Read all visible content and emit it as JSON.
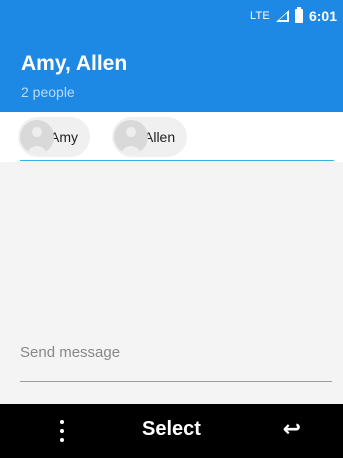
{
  "status_bar": {
    "network": "LTE",
    "time": "6:01"
  },
  "header": {
    "title": "Amy, Allen",
    "subtitle": "2 people"
  },
  "recipients": [
    {
      "name": "Amy"
    },
    {
      "name": "Allen"
    }
  ],
  "compose": {
    "placeholder": "Send message",
    "value": ""
  },
  "softkeys": {
    "left_icon": "more-vert-icon",
    "center_label": "Select",
    "right_icon": "back-icon",
    "right_glyph": "↩"
  },
  "colors": {
    "header_bg": "#1e88e5",
    "accent_line": "#33b5e5",
    "softkey_bg": "#000000"
  }
}
